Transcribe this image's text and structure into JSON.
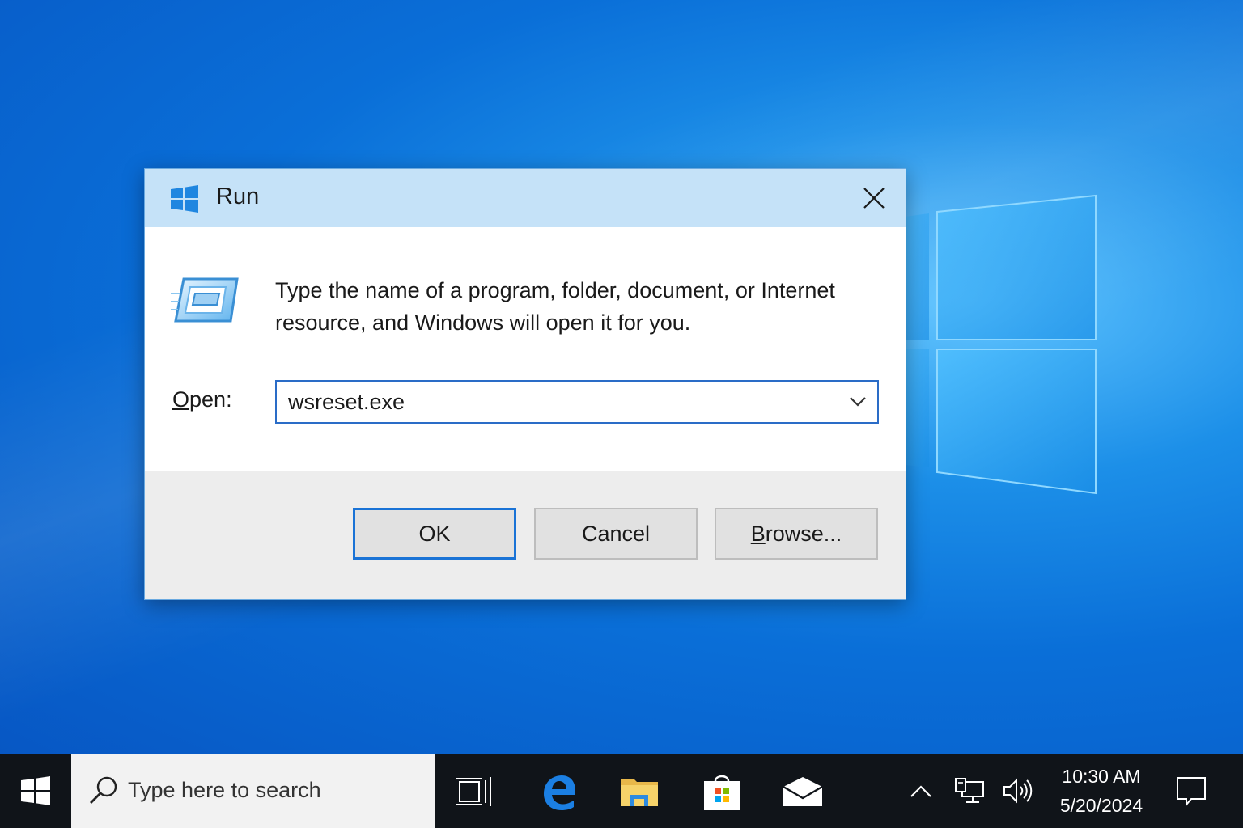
{
  "dialog": {
    "title": "Run",
    "description": "Type the name of a program, folder, document, or Internet resource, and Windows will open it for you.",
    "open_label_mnemonic": "O",
    "open_label_rest": "pen:",
    "open_value": "wsreset.exe",
    "ok_label": "OK",
    "cancel_label": "Cancel",
    "browse_mnemonic": "B",
    "browse_rest": "rowse..."
  },
  "taskbar": {
    "search_placeholder": "Type here to search",
    "pinned": [
      "task-view-icon",
      "edge-icon",
      "file-explorer-icon",
      "store-icon",
      "mail-icon"
    ],
    "tray": [
      "show-hidden-icons-icon",
      "network-icon",
      "volume-icon"
    ],
    "time": "10:30 AM",
    "date": "5/20/2024"
  },
  "colors": {
    "accent": "#1a73d6",
    "titlebar": "#c5e2f8",
    "taskbar": "#101419"
  }
}
